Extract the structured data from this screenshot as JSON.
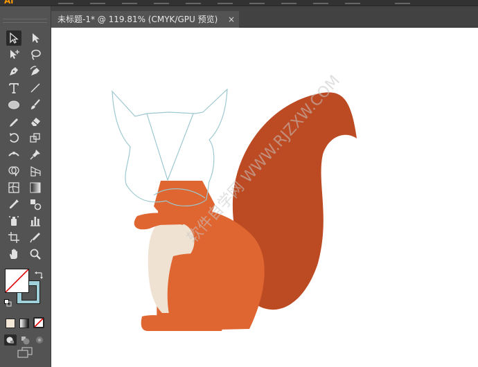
{
  "app": {
    "logo": "Ai"
  },
  "document_tab": {
    "title": "未标题-1* @ 119.81% (CMYK/GPU 预览)",
    "close_glyph": "×"
  },
  "tools": [
    "selection-tool",
    "direct-selection-tool",
    "magic-wand-tool",
    "lasso-tool",
    "pen-tool",
    "curvature-tool",
    "type-tool",
    "line-segment-tool",
    "ellipse-tool",
    "paintbrush-tool",
    "pencil-tool",
    "eraser-tool",
    "rotate-tool",
    "scale-tool",
    "width-tool",
    "free-transform-tool",
    "shape-builder-tool",
    "perspective-grid-tool",
    "mesh-tool",
    "gradient-tool",
    "eyedropper-tool",
    "blend-tool",
    "symbol-sprayer-tool",
    "column-graph-tool",
    "artboard-tool",
    "slice-tool",
    "hand-tool",
    "zoom-tool"
  ],
  "colors": {
    "fill": "#ffffff",
    "stroke": "#9fd0da",
    "toolbar_bg": "#535353",
    "menubar_bg": "#323232",
    "canvas_bg": "#ffffff",
    "squirrel_body": "#df6531",
    "squirrel_tail": "#bc4a22",
    "squirrel_belly": "#efe2d2",
    "head_outline": "#9cc8cf",
    "watermark": "#c8c8c8"
  },
  "watermark_text": "软件自学网 WWW.RJZXW.COM"
}
